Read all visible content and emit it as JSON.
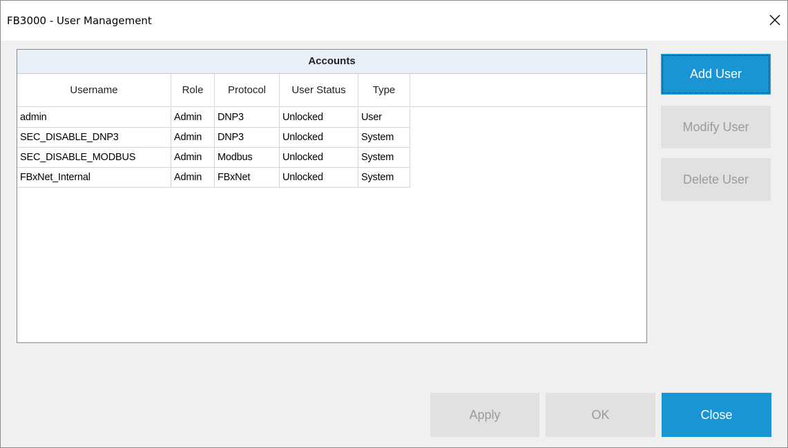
{
  "window": {
    "title": "FB3000 - User Management"
  },
  "icons": {
    "close": "close-icon"
  },
  "colors": {
    "accent": "#1a95d3",
    "disabled_bg": "#e1e1e1",
    "disabled_text": "#9a9a9a",
    "caption_bg": "#e9eff6"
  },
  "accounts": {
    "caption": "Accounts",
    "columns": [
      "Username",
      "Role",
      "Protocol",
      "User Status",
      "Type"
    ],
    "rows": [
      [
        "admin",
        "Admin",
        "DNP3",
        "Unlocked",
        "User"
      ],
      [
        "SEC_DISABLE_DNP3",
        "Admin",
        "DNP3",
        "Unlocked",
        "System"
      ],
      [
        "SEC_DISABLE_MODBUS",
        "Admin",
        "Modbus",
        "Unlocked",
        "System"
      ],
      [
        "FBxNet_Internal",
        "Admin",
        "FBxNet",
        "Unlocked",
        "System"
      ]
    ]
  },
  "side_buttons": {
    "add": "Add User",
    "modify": "Modify User",
    "delete": "Delete User"
  },
  "footer_buttons": {
    "apply": "Apply",
    "ok": "OK",
    "close": "Close"
  }
}
